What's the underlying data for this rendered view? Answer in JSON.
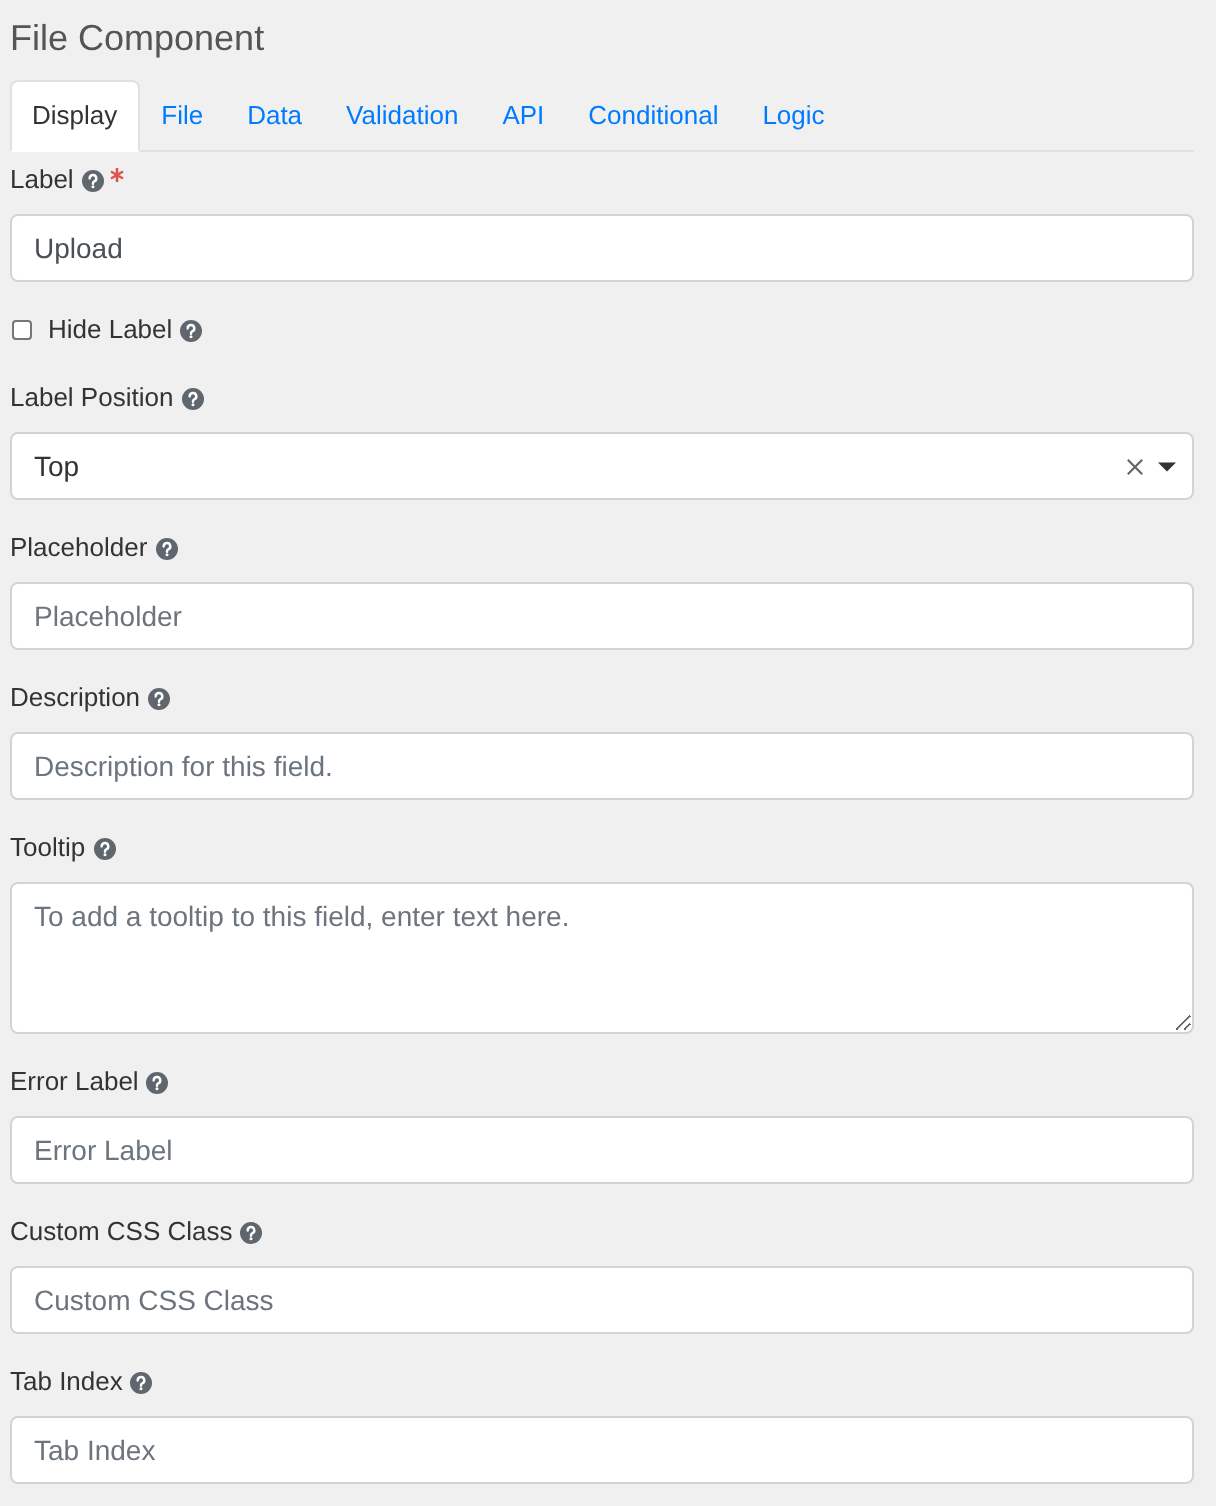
{
  "title": "File Component",
  "tabs": [
    {
      "label": "Display",
      "selected": true
    },
    {
      "label": "File",
      "selected": false
    },
    {
      "label": "Data",
      "selected": false
    },
    {
      "label": "Validation",
      "selected": false
    },
    {
      "label": "API",
      "selected": false
    },
    {
      "label": "Conditional",
      "selected": false
    },
    {
      "label": "Logic",
      "selected": false
    }
  ],
  "fields": [
    {
      "kind": "text",
      "label": "Label",
      "required": true,
      "value": "Upload"
    },
    {
      "kind": "checkbox",
      "label": "Hide Label",
      "required": false,
      "checked": false
    },
    {
      "kind": "select",
      "label": "Label Position",
      "required": false,
      "value": "Top"
    },
    {
      "kind": "text",
      "label": "Placeholder",
      "required": false,
      "placeholder": "Placeholder"
    },
    {
      "kind": "text",
      "label": "Description",
      "required": false,
      "placeholder": "Description for this field."
    },
    {
      "kind": "textarea",
      "label": "Tooltip",
      "required": false,
      "placeholder": "To add a tooltip to this field, enter text here."
    },
    {
      "kind": "text",
      "label": "Error Label",
      "required": false,
      "placeholder": "Error Label"
    },
    {
      "kind": "text",
      "label": "Custom CSS Class",
      "required": false,
      "placeholder": "Custom CSS Class"
    },
    {
      "kind": "text",
      "label": "Tab Index",
      "required": false,
      "placeholder": "Tab Index"
    }
  ]
}
